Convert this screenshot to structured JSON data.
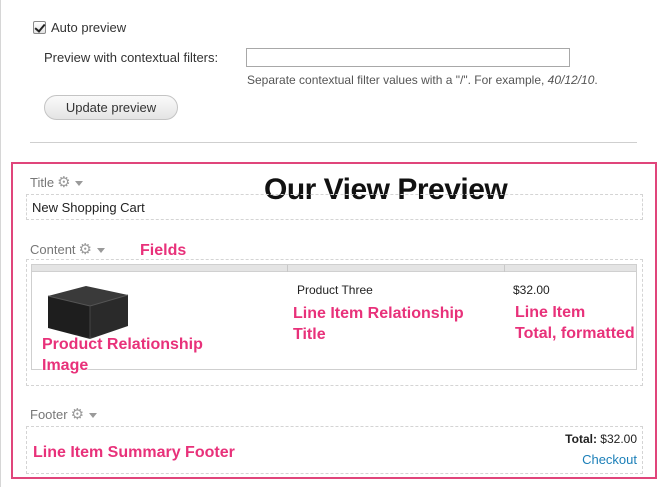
{
  "preview_settings": {
    "auto_preview_label": "Auto preview",
    "auto_preview_checked": true,
    "contextual_filters_label": "Preview with contextual filters:",
    "contextual_filters_value": "",
    "contextual_filters_help": "Separate contextual filter values with a \"/\". For example, ",
    "contextual_filters_example": "40/12/10",
    "contextual_filters_help_end": ".",
    "update_button": "Update preview"
  },
  "preview": {
    "heading": "Our View Preview",
    "title_section": {
      "label": "Title",
      "value": "New Shopping Cart"
    },
    "content_section": {
      "label": "Content",
      "annotation": "Fields",
      "rows": [
        {
          "image_icon": "product-box-image",
          "title": "Product Three",
          "total": "$32.00"
        }
      ],
      "annotations": {
        "image": [
          "Product Relationship",
          "Image"
        ],
        "title": [
          "Line Item Relationship",
          "Title"
        ],
        "total": [
          "Line Item",
          "Total, formatted"
        ]
      }
    },
    "footer_section": {
      "label": "Footer",
      "annotation": "Line Item Summary Footer",
      "total_label": "Total:",
      "total_value": "$32.00",
      "checkout_link": "Checkout"
    }
  },
  "colors": {
    "annotation_pink": "#e8317a",
    "frame_pink": "#e0457b",
    "link_blue": "#1b7fb8"
  },
  "icons": {
    "gear": "gear-icon",
    "caret": "chevron-down-icon",
    "checkbox": "checkbox-checked-icon"
  }
}
